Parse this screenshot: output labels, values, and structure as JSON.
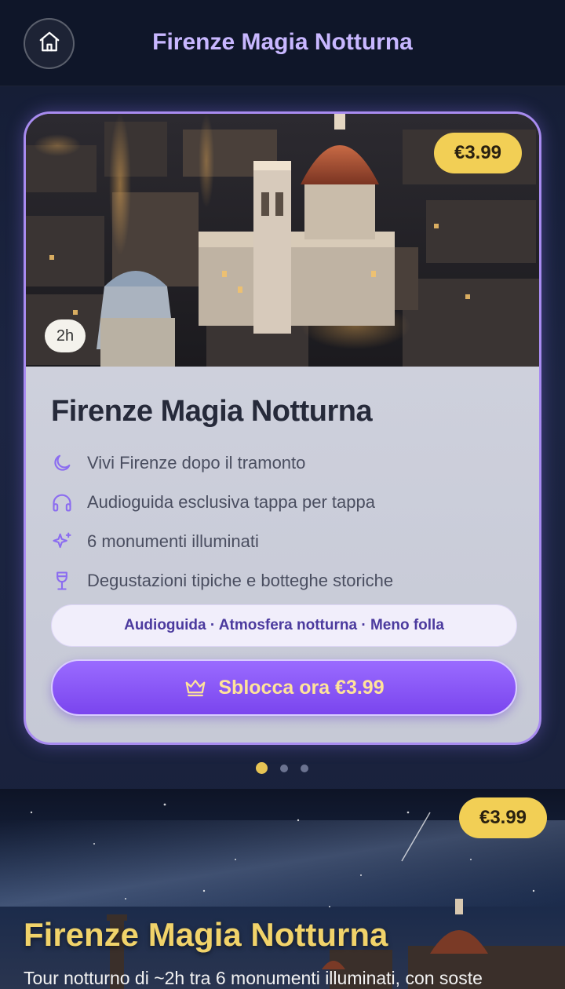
{
  "header": {
    "title": "Firenze Magia Notturna",
    "home_icon": "home-icon"
  },
  "card": {
    "price": "€3.99",
    "duration": "2h",
    "title": "Firenze Magia Notturna",
    "features": [
      {
        "icon": "moon-icon",
        "text": "Vivi Firenze dopo il tramonto"
      },
      {
        "icon": "headphones-icon",
        "text": "Audioguida esclusiva tappa per tappa"
      },
      {
        "icon": "sparkles-icon",
        "text": "6 monumenti illuminati"
      },
      {
        "icon": "wine-glass-icon",
        "text": "Degustazioni tipiche e botteghe storiche"
      }
    ],
    "tags": "Audioguida · Atmosfera notturna · Meno folla",
    "cta_label": "Sblocca ora €3.99",
    "cta_icon": "crown-icon"
  },
  "carousel": {
    "pages": 3,
    "active": 0
  },
  "card2": {
    "price": "€3.99",
    "title": "Firenze Magia Notturna",
    "description": "Tour notturno di ~2h tra 6 monumenti illuminati, con soste"
  },
  "colors": {
    "accent": "#8b5cf6",
    "gold": "#f2cf55",
    "header_title": "#c8b7ff",
    "background": "#1c2542"
  }
}
